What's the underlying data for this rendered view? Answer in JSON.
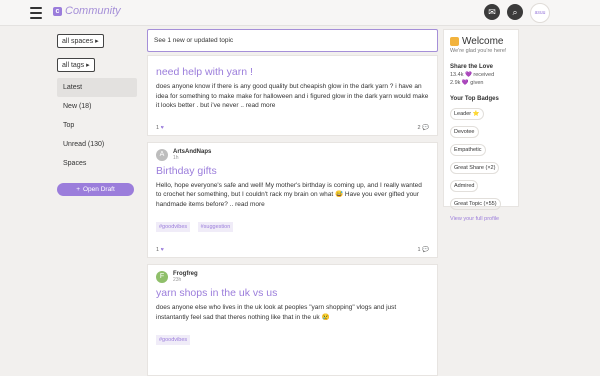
{
  "brand": {
    "name": "Community",
    "initial": "c"
  },
  "header": {
    "chat_icon": "chat-icon",
    "search_icon": "search-icon",
    "avatar_text": "asuu"
  },
  "filters": {
    "spaces": "all spaces",
    "tags": "all tags"
  },
  "nav": {
    "items": [
      "Latest",
      "New (18)",
      "Top",
      "Unread (130)",
      "Spaces"
    ],
    "draft_button": "Open Draft"
  },
  "banner": {
    "text": "See 1 new or updated topic"
  },
  "posts": [
    {
      "title": "need help with yarn !",
      "excerpt": "does anyone know if there is any good quality but cheapish glow in the dark yarn ? i have an idea for something to make make for halloween and i figured glow in the dark yarn would make it looks better . but i've never .. read more",
      "likes": "1",
      "replies": "2"
    },
    {
      "author": "ArtsAndNaps",
      "author_initial": "A",
      "time": "1h",
      "title": "Birthday gifts",
      "excerpt": "Hello, hope everyone's safe and well! My mother's birthday is coming up, and I really wanted to crochet her something, but I couldn't rack my brain on what 😅 Have you ever gifted your handmade items before? .. read more",
      "tags": [
        "#goodvibes",
        "#suggestion"
      ],
      "likes": "1",
      "replies": "1"
    },
    {
      "author": "Frogfreg",
      "author_initial": "F",
      "time": "23h",
      "title": "yarn shops in the uk vs us",
      "excerpt": "does anyone else who lives in the uk look at peoples \"yarn shopping\" vlogs and just instantantly feel sad that theres nothing like that in the uk 😢",
      "tags": [
        "#goodvibes"
      ]
    }
  ],
  "sidebar": {
    "welcome": "Welcome",
    "sub": "We're glad you're here!",
    "love_heading": "Share the Love",
    "received": "13.4k 💜 received",
    "given": "2.9k 💜 given",
    "badges_heading": "Your Top Badges",
    "badges": [
      "Leader ⭐",
      "Devotee",
      "Empathetic",
      "Great Share (×2)",
      "Admired",
      "Great Topic (×55)"
    ],
    "profile_link": "View your full profile"
  }
}
